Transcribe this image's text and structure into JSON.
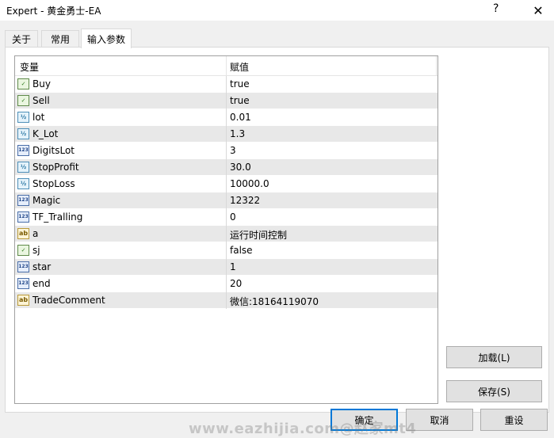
{
  "window": {
    "title": "Expert - 黄金勇士-EA",
    "help_glyph": "?",
    "close_glyph": "✕"
  },
  "tabs": [
    {
      "label": "关于"
    },
    {
      "label": "常用"
    },
    {
      "label": "输入参数"
    }
  ],
  "grid": {
    "col_variable": "变量",
    "col_value": "赋值",
    "rows": [
      {
        "icon": "bool",
        "icon_text": "✓",
        "name": "Buy",
        "value": "true"
      },
      {
        "icon": "bool",
        "icon_text": "✓",
        "name": "Sell",
        "value": "true"
      },
      {
        "icon": "dbl",
        "icon_text": "½",
        "name": "lot",
        "value": "0.01"
      },
      {
        "icon": "dbl",
        "icon_text": "½",
        "name": "K_Lot",
        "value": "1.3"
      },
      {
        "icon": "int",
        "icon_text": "123",
        "name": "DigitsLot",
        "value": "3"
      },
      {
        "icon": "dbl",
        "icon_text": "½",
        "name": "StopProfit",
        "value": "30.0"
      },
      {
        "icon": "dbl",
        "icon_text": "½",
        "name": "StopLoss",
        "value": "10000.0"
      },
      {
        "icon": "int",
        "icon_text": "123",
        "name": "Magic",
        "value": "12322"
      },
      {
        "icon": "int",
        "icon_text": "123",
        "name": "TF_Tralling",
        "value": "0"
      },
      {
        "icon": "str",
        "icon_text": "ab",
        "name": "a",
        "value": "运行时间控制"
      },
      {
        "icon": "bool",
        "icon_text": "✓",
        "name": "sj",
        "value": "false"
      },
      {
        "icon": "int",
        "icon_text": "123",
        "name": "star",
        "value": "1"
      },
      {
        "icon": "int",
        "icon_text": "123",
        "name": "end",
        "value": "20"
      },
      {
        "icon": "str",
        "icon_text": "ab",
        "name": "TradeComment",
        "value": "微信:18164119070"
      }
    ]
  },
  "buttons": {
    "load": "加载(L)",
    "save": "保存(S)",
    "ok": "确定",
    "cancel": "取消",
    "reset": "重设"
  },
  "watermark": "www.eazhijia.com@赵家mt4"
}
